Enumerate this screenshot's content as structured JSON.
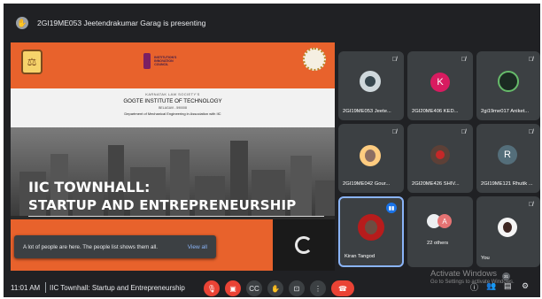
{
  "presenting_banner": {
    "text": "2GI19ME053 Jeetendrakumar Garag is presenting",
    "icon": "hand-raise-icon"
  },
  "slide": {
    "institute_line1": "KARNATAK LAW SOCIETY'S",
    "institute_name": "GOGTE INSTITUTE OF TECHNOLOGY",
    "city": "BELAGAVI - 590008",
    "department": "Department of Mechanical Engineering in Association with IIC",
    "iic_logo_text": "INSTITUTION'S INNOVATION COUNCIL",
    "title_line1": "IIC TOWNHALL:",
    "title_line2": "STARTUP AND ENTREPRENEURSHIP",
    "accent_color": "#e8622c"
  },
  "toast": {
    "message": "A lot of people are here. The people list shows them all.",
    "action": "View all"
  },
  "participants": [
    {
      "name": "2GI19ME053 Jeete...",
      "avatar_type": "photo",
      "muted": true
    },
    {
      "name": "2GI20ME406 KED...",
      "avatar_type": "letter",
      "letter": "K",
      "color": "#d81b60",
      "muted": true
    },
    {
      "name": "2gi19me017 Aniket...",
      "avatar_type": "photo",
      "muted": true
    },
    {
      "name": "2GI19ME042 Gour...",
      "avatar_type": "photo",
      "muted": true
    },
    {
      "name": "2GI20ME426 SHIV...",
      "avatar_type": "photo",
      "muted": true
    },
    {
      "name": "2GI19ME121 Rhutik ...",
      "avatar_type": "letter",
      "letter": "R",
      "color": "#546e7a",
      "muted": true
    },
    {
      "name": "Kiran Tangod",
      "avatar_type": "photo",
      "speaking": true
    },
    {
      "name": "22 others",
      "avatar_type": "group",
      "letter": "A",
      "color": "#e57373"
    },
    {
      "name": "You",
      "avatar_type": "photo",
      "muted": true
    }
  ],
  "bottom_bar": {
    "time": "11:01 AM",
    "meeting_title": "IIC Townhall: Startup and Entrepreneurship",
    "people_count": "31"
  },
  "watermark": {
    "line1": "Activate Windows",
    "line2": "Go to Settings to activate Windows."
  }
}
